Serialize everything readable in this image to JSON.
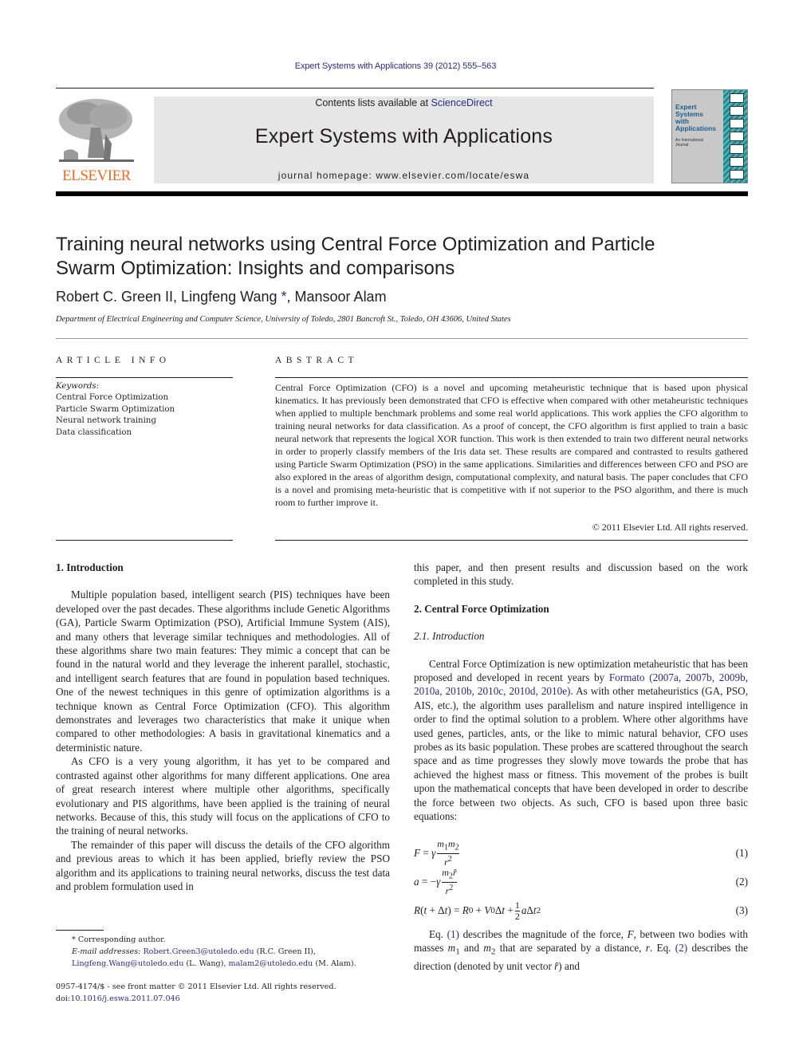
{
  "header": {
    "citation": "Expert Systems with Applications 39 (2012) 555–563",
    "publisher_logo_text": "ELSEVIER",
    "contents_prefix": "Contents lists available at ",
    "contents_link": "ScienceDirect",
    "journal_title": "Expert Systems with Applications",
    "homepage": "journal homepage: www.elsevier.com/locate/eswa",
    "cover": {
      "title_lines": [
        "Expert",
        "Systems",
        "with",
        "Applications"
      ],
      "subtitle_lines": [
        "An International",
        "Journal"
      ],
      "strip_color": "#1f8a8f"
    }
  },
  "article": {
    "title": "Training neural networks using Central Force Optimization and Particle Swarm Optimization: Insights and comparisons",
    "authors": "Robert C. Green II, Lingfeng Wang",
    "authors_star": "*",
    "authors_tail": ", Mansoor Alam",
    "affiliation": "Department of Electrical Engineering and Computer Science, University of Toledo, 2801 Bancroft St., Toledo, OH 43606, United States"
  },
  "article_info": {
    "heading": "ARTICLE INFO",
    "keywords_label": "Keywords:",
    "keywords": [
      "Central Force Optimization",
      "Particle Swarm Optimization",
      "Neural network training",
      "Data classification"
    ]
  },
  "abstract": {
    "heading": "ABSTRACT",
    "text": "Central Force Optimization (CFO) is a novel and upcoming metaheuristic technique that is based upon physical kinematics. It has previously been demonstrated that CFO is effective when compared with other metaheuristic techniques when applied to multiple benchmark problems and some real world applications. This work applies the CFO algorithm to training neural networks for data classification. As a proof of concept, the CFO algorithm is first applied to train a basic neural network that represents the logical XOR function. This work is then extended to train two different neural networks in order to properly classify members of the Iris data set. These results are compared and contrasted to results gathered using Particle Swarm Optimization (PSO) in the same applications. Similarities and differences between CFO and PSO are also explored in the areas of algorithm design, computational complexity, and natural basis. The paper concludes that CFO is a novel and promising meta-heuristic that is competitive with if not superior to the PSO algorithm, and there is much room to further improve it.",
    "copyright": "© 2011 Elsevier Ltd. All rights reserved."
  },
  "body": {
    "section1_title": "1. Introduction",
    "section1_paragraphs": [
      "Multiple population based, intelligent search (PIS) techniques have been developed over the past decades. These algorithms include Genetic Algorithms (GA), Particle Swarm Optimization (PSO), Artificial Immune System (AIS), and many others that leverage similar techniques and methodologies. All of these algorithms share two main features: They mimic a concept that can be found in the natural world and they leverage the inherent parallel, stochastic, and intelligent search features that are found in population based techniques. One of the newest techniques in this genre of optimization algorithms is a technique known as Central Force Optimization (CFO). This algorithm demonstrates and leverages two characteristics that make it unique when compared to other methodologies: A basis in gravitational kinematics and a deterministic nature.",
      "As CFO is a very young algorithm, it has yet to be compared and contrasted against other algorithms for many different applications. One area of great research interest where multiple other algorithms, specifically evolutionary and PIS algorithms, have been applied is the training of neural networks. Because of this, this study will focus on the applications of CFO to the training of neural networks.",
      "The remainder of this paper will discuss the details of the CFO algorithm and previous areas to which it has been applied, briefly review the PSO algorithm and its applications to training neural networks, discuss the test data and problem formulation used in"
    ],
    "section1_continuation": "this paper, and then present results and discussion based on the work completed in this study.",
    "section2_title": "2. Central Force Optimization",
    "subsection21_title": "2.1. Introduction",
    "section2_p1_a": "Central Force Optimization is new optimization metaheuristic that has been proposed and developed in recent years by ",
    "section2_p1_link": "Formato (2007a, 2007b, 2009b, 2010a, 2010b, 2010c, 2010d, 2010e)",
    "section2_p1_b": ". As with other metaheuristics (GA, PSO, AIS, etc.), the algorithm uses parallelism and nature inspired intelligence in order to find the optimal solution to a problem. Where other algorithms have used genes, particles, ants, or the like to mimic natural behavior, CFO uses probes as its basic population. These probes are scattered throughout the search space and as time progresses they slowly move towards the probe that has achieved the highest mass or fitness. This movement of the probes is built upon the mathematical concepts that have been developed in order to describe the force between two objects. As such, CFO is based upon three basic equations:",
    "equations": [
      {
        "number": "(1)"
      },
      {
        "number": "(2)"
      },
      {
        "number": "(3)"
      }
    ],
    "eq_ref1": "(1)",
    "eq_ref2": "(2)"
  },
  "footnote": {
    "star": "*",
    "corresponding": "Corresponding author.",
    "email_label": "E-mail addresses:",
    "email1": "Robert.Green3@utoledo.edu",
    "email1_who": " (R.C. Green II), ",
    "email2": "Lingfeng.Wang@utoledo.edu",
    "email2_who": " (L. Wang), ",
    "email3": "malam2@utoledo.edu",
    "email3_who": " (M. Alam).",
    "frontmatter": "0957-4174/$ - see front matter © 2011 Elsevier Ltd. All rights reserved.",
    "doi_label": "doi:",
    "doi": "10.1016/j.eswa.2011.07.046"
  }
}
